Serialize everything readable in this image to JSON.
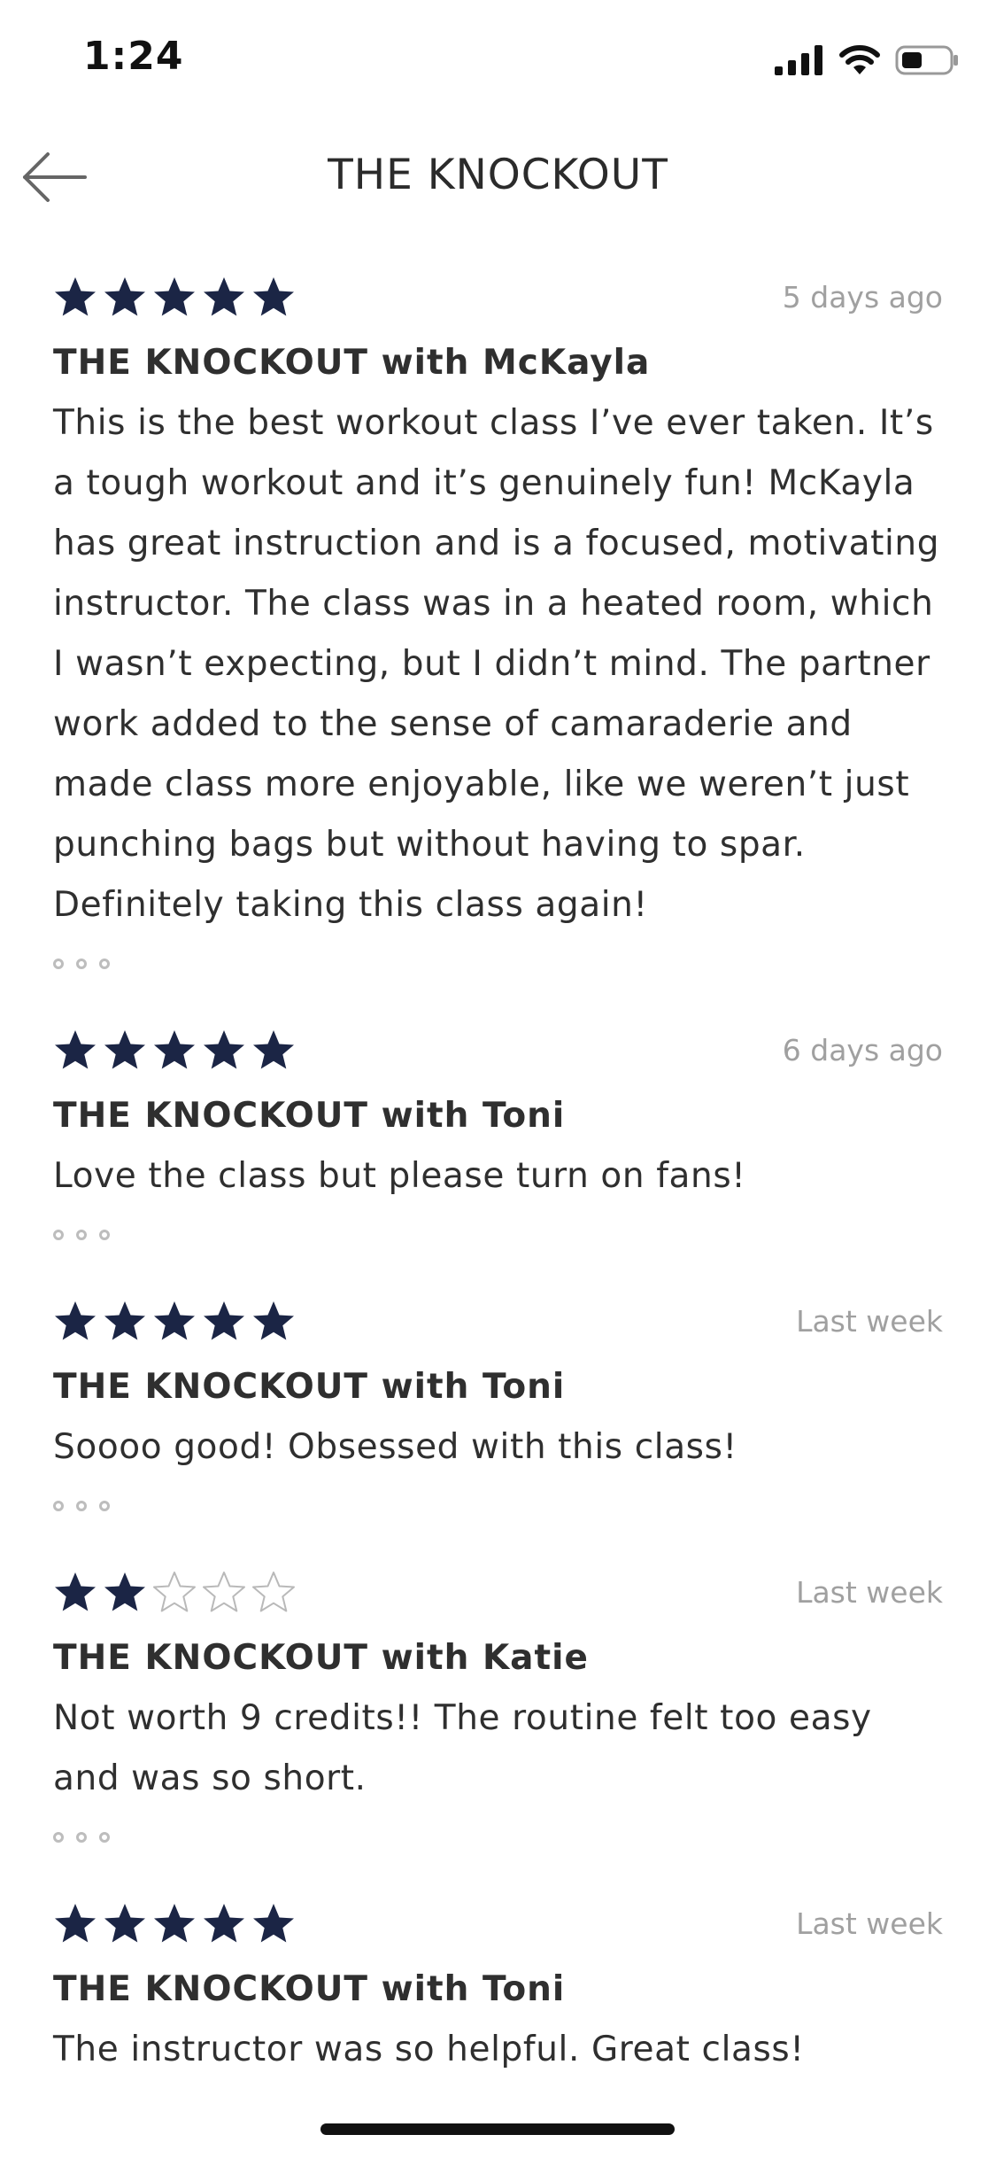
{
  "status": {
    "time": "1:24"
  },
  "nav": {
    "title": "THE KNOCKOUT"
  },
  "colors": {
    "star_filled": "#1b2545",
    "star_empty": "#b9b9b9"
  },
  "reviews": [
    {
      "rating": 5,
      "date": "5 days ago",
      "title": "THE KNOCKOUT with McKayla",
      "text": "This is the best workout class I’ve ever taken. It’s a tough workout and it’s genuinely fun! McKayla has great instruction and is a focused, motivating instructor. The class was in a heated room, which I wasn’t expecting, but I didn’t mind. The partner work added to the sense of camaraderie and made class more enjoyable, like we weren’t just punching bags but without having to spar. Definitely taking this class again!"
    },
    {
      "rating": 5,
      "date": "6 days ago",
      "title": "THE KNOCKOUT with Toni",
      "text": "Love the class but please turn on fans!"
    },
    {
      "rating": 5,
      "date": "Last week",
      "title": "THE KNOCKOUT with Toni",
      "text": "Soooo good! Obsessed with this class!"
    },
    {
      "rating": 2,
      "date": "Last week",
      "title": "THE KNOCKOUT with Katie",
      "text": "Not worth 9 credits!! The routine felt too easy and was so short."
    },
    {
      "rating": 5,
      "date": "Last week",
      "title": "THE KNOCKOUT with Toni",
      "text": "The instructor was so helpful. Great class!"
    }
  ]
}
